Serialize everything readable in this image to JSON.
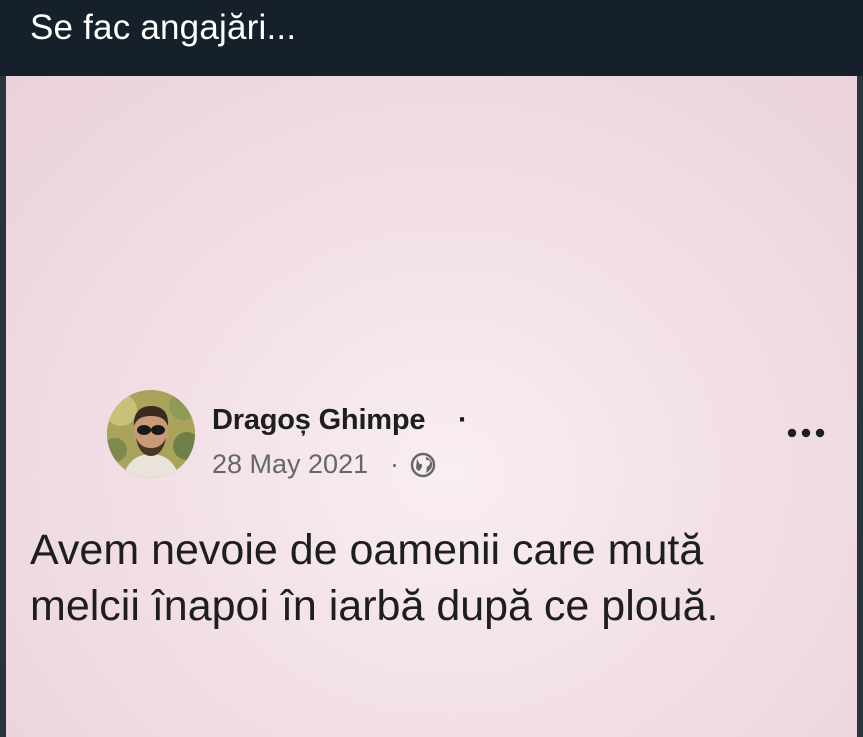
{
  "header": {
    "title": "Se fac angajări..."
  },
  "post": {
    "author": "Dragoș Ghimpe",
    "name_separator": "·",
    "date": "28 May 2021",
    "date_separator": "·",
    "audience_icon": "globe-icon",
    "more_icon": "more-options-icon",
    "text": "Avem nevoie de oamenii care mută\nmelcii înapoi în iarbă după ce plouă."
  },
  "colors": {
    "header_bg": "#15202b",
    "card_bg": "#f2e0e6",
    "name_text": "#1c1e21",
    "meta_text": "#65676b"
  }
}
